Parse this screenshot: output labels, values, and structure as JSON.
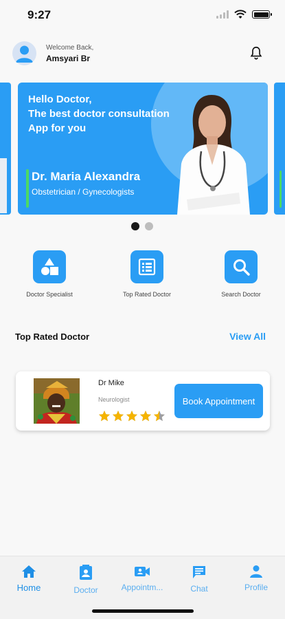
{
  "status_bar": {
    "time": "9:27"
  },
  "header": {
    "welcome": "Welcome Back,",
    "user_name": "Amsyari Br"
  },
  "banner": {
    "greeting": "Hello Doctor,",
    "tagline": "The best doctor consultation App for you",
    "doctor_name": "Dr. Maria Alexandra",
    "doctor_specialty": "Obstetrician / Gynecologists"
  },
  "carousel": {
    "active_index": 0,
    "count": 2
  },
  "categories": [
    {
      "label": "Doctor Specialist",
      "icon": "shapes-icon"
    },
    {
      "label": "Top Rated Doctor",
      "icon": "list-icon"
    },
    {
      "label": "Search Doctor",
      "icon": "search-icon"
    }
  ],
  "top_rated": {
    "title": "Top Rated Doctor",
    "view_all": "View All",
    "doctors": [
      {
        "name": "Dr Mike",
        "specialty": "Neurologist",
        "rating": 4.5,
        "max_rating": 5,
        "button": "Book Appointment"
      }
    ]
  },
  "nav": [
    {
      "label": "Home",
      "icon": "home-icon",
      "active": true
    },
    {
      "label": "Doctor",
      "icon": "doctor-icon",
      "active": false
    },
    {
      "label": "Appointm...",
      "icon": "video-icon",
      "active": false
    },
    {
      "label": "Chat",
      "icon": "chat-icon",
      "active": false
    },
    {
      "label": "Profile",
      "icon": "profile-icon",
      "active": false
    }
  ],
  "colors": {
    "accent": "#2a9df4",
    "banner_bar": "#4cd964",
    "star": "#f5b400"
  }
}
